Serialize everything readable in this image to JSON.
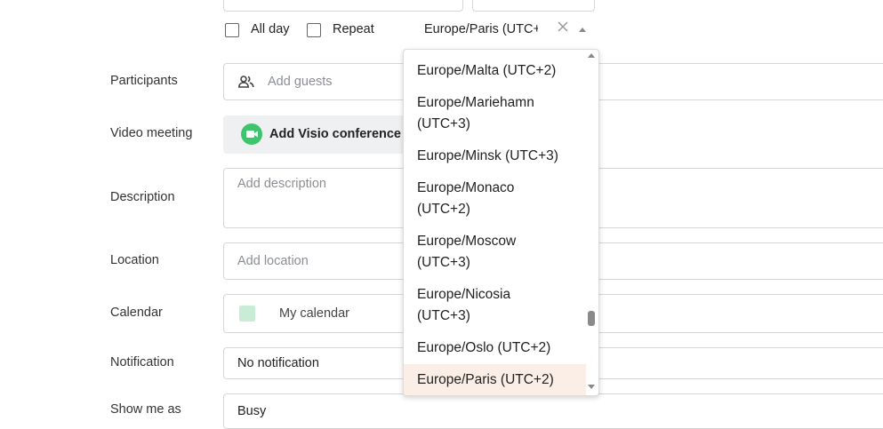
{
  "options_row": {
    "all_day_label": "All day",
    "repeat_label": "Repeat",
    "timezone_value": "Europe/Paris (UTC+",
    "clear_icon": "close-icon",
    "toggle_icon": "caret-up-icon"
  },
  "participants": {
    "label": "Participants",
    "placeholder": "Add guests",
    "icon": "people-icon"
  },
  "video": {
    "label": "Video meeting",
    "button_label": "Add Visio conference",
    "icon": "video-camera-icon",
    "icon_color": "#3ec46d"
  },
  "description": {
    "label": "Description",
    "placeholder": "Add description"
  },
  "location": {
    "label": "Location",
    "placeholder": "Add location"
  },
  "calendar": {
    "label": "Calendar",
    "value": "My calendar",
    "swatch_color": "#c9ecd6"
  },
  "notification": {
    "label": "Notification",
    "value": "No notification"
  },
  "show_me_as": {
    "label": "Show me as",
    "value": "Busy"
  },
  "timezone_dropdown": {
    "options": [
      {
        "line1": "Europe/Malta (UTC+2)"
      },
      {
        "line1": "Europe/Mariehamn",
        "line2": "(UTC+3)"
      },
      {
        "line1": "Europe/Minsk (UTC+3)"
      },
      {
        "line1": "Europe/Monaco",
        "line2": "(UTC+2)"
      },
      {
        "line1": "Europe/Moscow",
        "line2": "(UTC+3)"
      },
      {
        "line1": "Europe/Nicosia",
        "line2": "(UTC+3)"
      },
      {
        "line1": "Europe/Oslo (UTC+2)"
      },
      {
        "line1": "Europe/Paris (UTC+2)",
        "selected": true
      }
    ]
  }
}
